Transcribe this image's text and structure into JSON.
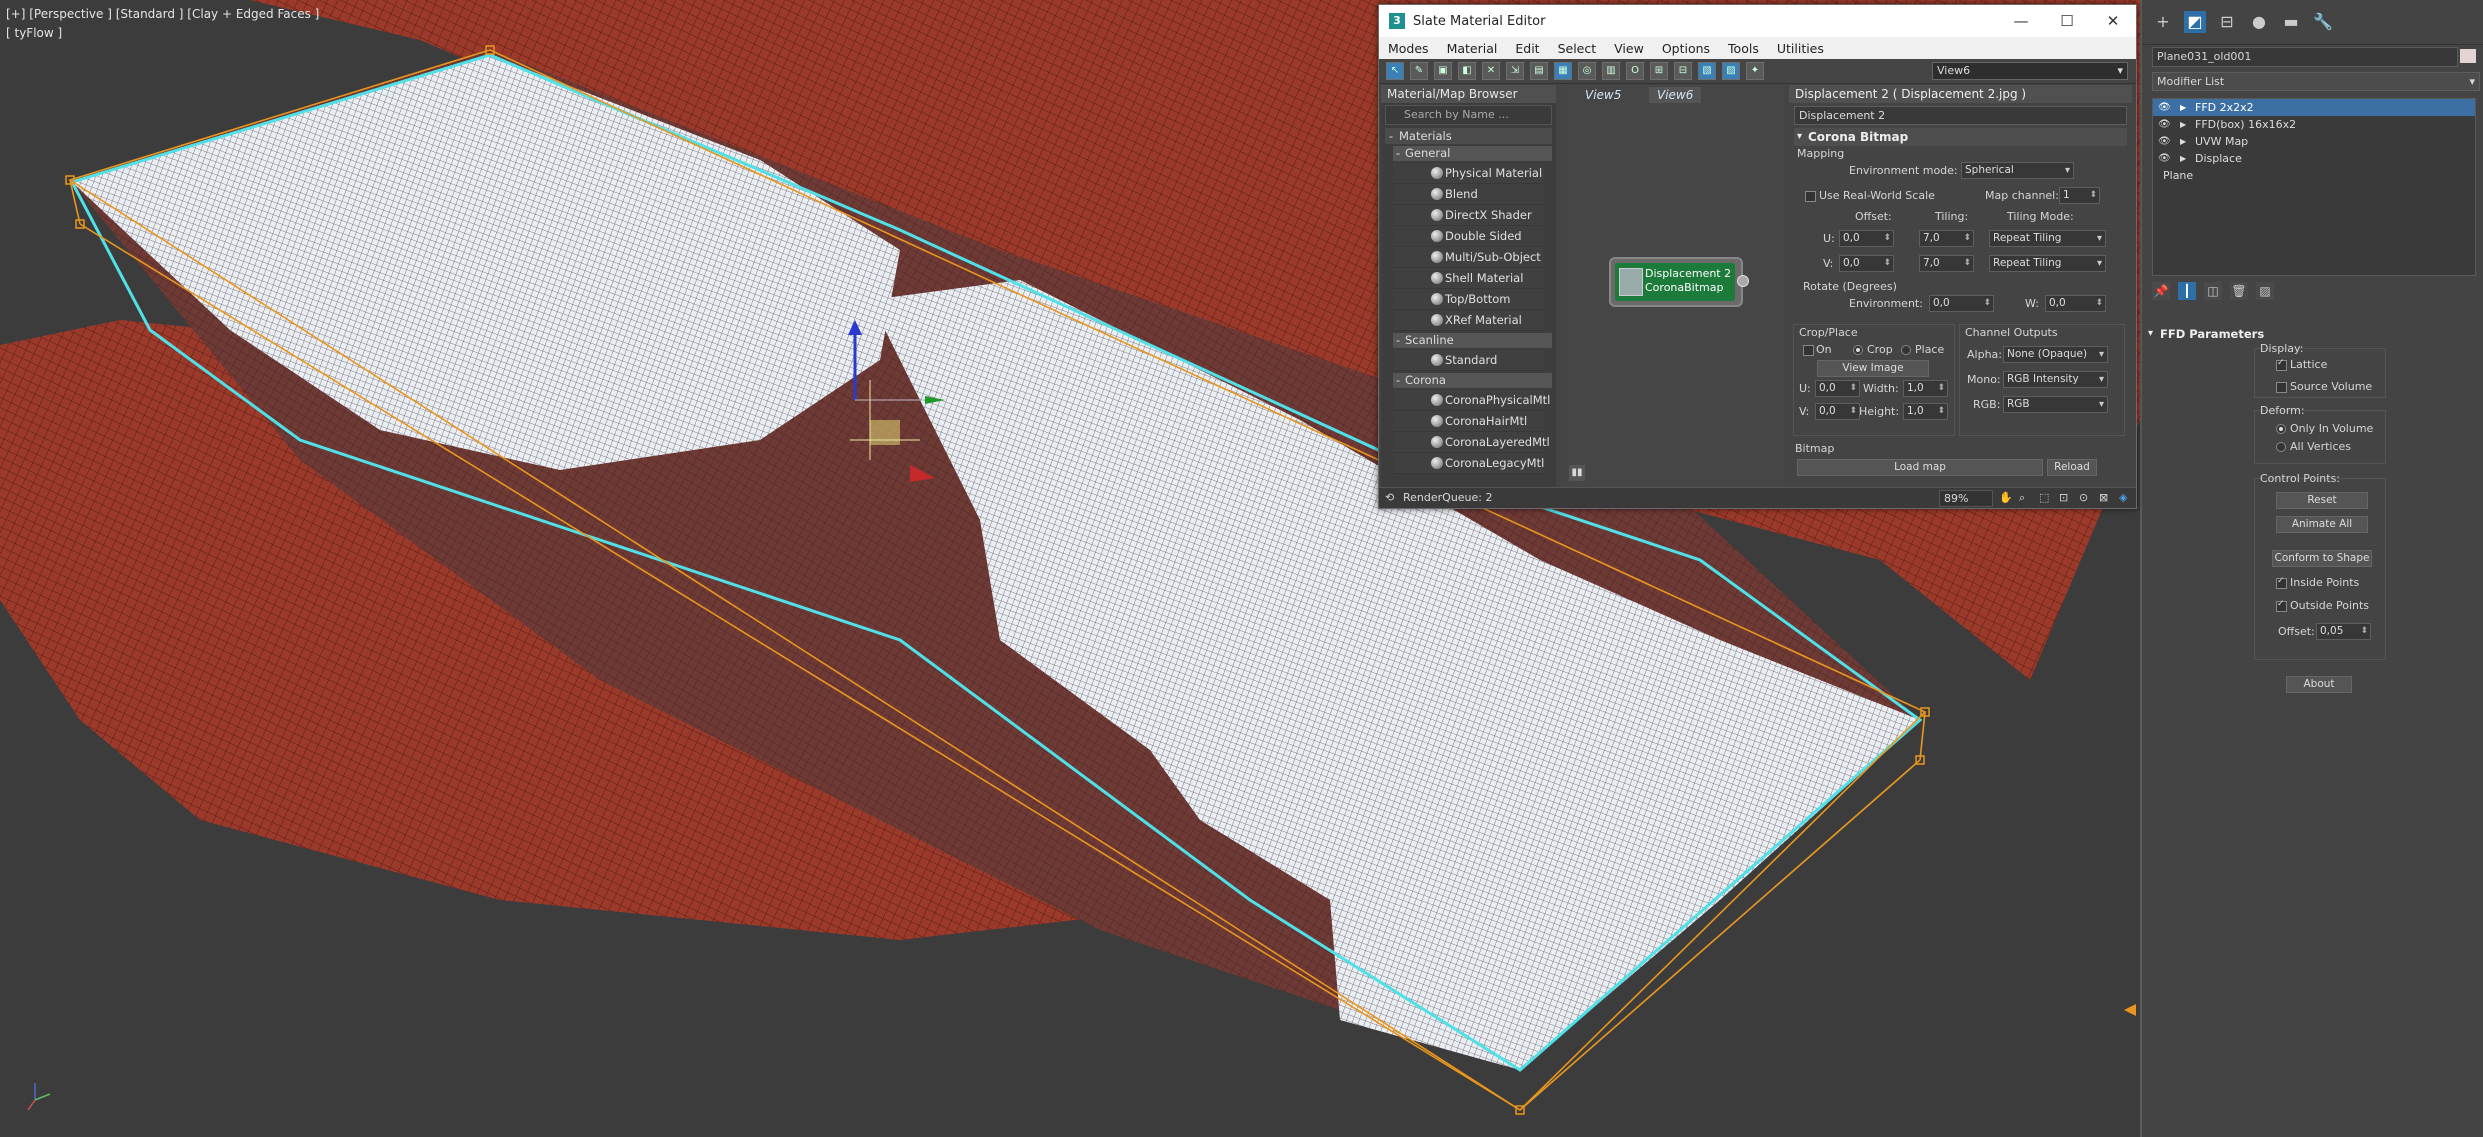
{
  "viewport": {
    "label": "[+] [Perspective ] [Standard ] [Clay + Edged Faces ]",
    "sublabel": "[ tyFlow ]"
  },
  "sme": {
    "title": "Slate Material Editor",
    "window_buttons": {
      "minimize": "—",
      "maximize": "☐",
      "close": "✕"
    },
    "menu": [
      "Modes",
      "Material",
      "Edit",
      "Select",
      "View",
      "Options",
      "Tools",
      "Utilities"
    ],
    "view_select": "View6",
    "browser": {
      "title": "Material/Map Browser",
      "search_placeholder": "Search by Name ...",
      "group": "Materials",
      "subgroups": {
        "general": "General",
        "scanline": "Scanline",
        "corona": "Corona"
      },
      "general_items": [
        "Physical Material",
        "Blend",
        "DirectX Shader",
        "Double Sided",
        "Multi/Sub-Object",
        "Shell Material",
        "Top/Bottom",
        "XRef Material"
      ],
      "scanline_items": [
        "Standard"
      ],
      "corona_items": [
        "CoronaPhysicalMtl",
        "CoronaHairMtl",
        "CoronaLayeredMtl",
        "CoronaLegacyMtl"
      ]
    },
    "view_tabs": [
      "View5",
      "View6"
    ],
    "node": {
      "line1": "Displacement 2",
      "line2": "CoronaBitmap"
    },
    "params": {
      "header": "Displacement 2  ( Displacement 2.jpg )",
      "name": "Displacement 2",
      "rollout": "Corona Bitmap",
      "mapping_label": "Mapping",
      "env_mode_label": "Environment mode:",
      "env_mode_value": "Spherical",
      "real_world": "Use Real-World Scale",
      "map_channel_label": "Map channel:",
      "map_channel_value": "1",
      "offset_label": "Offset:",
      "tiling_label": "Tiling:",
      "tiling_mode_label": "Tiling Mode:",
      "u_label": "U:",
      "v_label": "V:",
      "u_offset": "0,0",
      "v_offset": "0,0",
      "u_tiling": "7,0",
      "v_tiling": "7,0",
      "u_mode": "Repeat Tiling",
      "v_mode": "Repeat Tiling",
      "rotate_label": "Rotate (Degrees)",
      "environment_label": "Environment:",
      "environment_value": "0,0",
      "w_label": "W:",
      "w_value": "0,0",
      "crop_title": "Crop/Place",
      "crop_on": "On",
      "crop_crop": "Crop",
      "crop_place": "Place",
      "view_image": "View Image",
      "crop_u_label": "U:",
      "crop_u": "0,0",
      "crop_v_label": "V:",
      "crop_v": "0,0",
      "width_label": "Width:",
      "width": "1,0",
      "height_label": "Height:",
      "height": "1,0",
      "channel_title": "Channel Outputs",
      "alpha_label": "Alpha:",
      "alpha": "None (Opaque)",
      "mono_label": "Mono:",
      "mono": "RGB Intensity",
      "rgb_label": "RGB:",
      "rgb": "RGB",
      "bitmap_label": "Bitmap",
      "load_map": "Load map",
      "reload": "Reload"
    },
    "status": {
      "render_queue": "RenderQueue: 2",
      "zoom": "89%"
    }
  },
  "cmd": {
    "object_name": "Plane031_old001",
    "modifier_list": "Modifier List",
    "object_color": "#e4d3d3",
    "stack": [
      {
        "label": "FFD 2x2x2",
        "selected": true
      },
      {
        "label": "FFD(box) 16x16x2",
        "selected": false
      },
      {
        "label": "UVW Map",
        "selected": false
      },
      {
        "label": "Displace",
        "selected": false
      }
    ],
    "stack_base": "Plane",
    "ffd": {
      "title": "FFD Parameters",
      "display": "Display:",
      "lattice": "Lattice",
      "source_volume": "Source Volume",
      "deform": "Deform:",
      "only_in_volume": "Only In Volume",
      "all_vertices": "All Vertices",
      "control_points": "Control Points:",
      "reset": "Reset",
      "animate_all": "Animate All",
      "conform": "Conform to Shape",
      "inside_points": "Inside Points",
      "outside_points": "Outside Points",
      "offset_label": "Offset:",
      "offset_value": "0,05",
      "about": "About"
    }
  },
  "colors": {
    "terrain": "#9b3a2a",
    "lattice": "#e8961e",
    "selection": "#4fe0e8",
    "node": "#1c7a3a"
  }
}
